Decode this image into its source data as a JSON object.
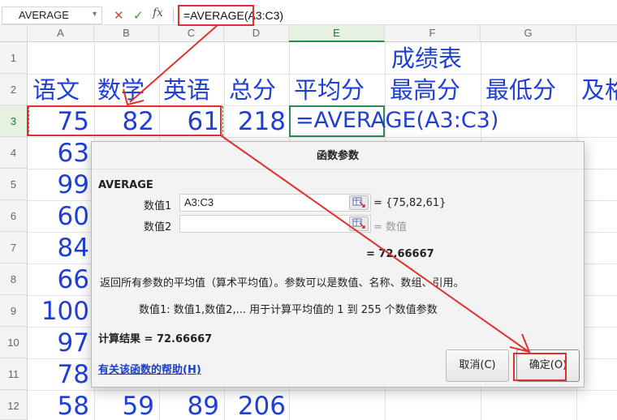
{
  "formula_bar": {
    "name_box": "AVERAGE",
    "cancel_symbol": "✕",
    "confirm_symbol": "✓",
    "fx_symbol": "fx",
    "formula": "=AVERAGE(A3:C3)"
  },
  "columns": [
    "A",
    "B",
    "C",
    "D",
    "E",
    "F",
    "G"
  ],
  "rows": [
    "1",
    "2",
    "3",
    "4",
    "5",
    "6",
    "7",
    "8",
    "9",
    "10",
    "11",
    "12"
  ],
  "sheet": {
    "title": "成绩表",
    "headers": [
      "语文",
      "数学",
      "英语",
      "总分",
      "平均分",
      "最高分",
      "最低分",
      "及格"
    ],
    "row3": {
      "a": "75",
      "b": "82",
      "c": "61",
      "d": "218",
      "e": "=AVERAGE(A3:C3)"
    },
    "col_a": [
      "63",
      "99",
      "60",
      "84",
      "66",
      "100",
      "97",
      "78",
      "58"
    ],
    "row12": {
      "b": "59",
      "c": "89",
      "d": "206"
    }
  },
  "dialog": {
    "title": "函数参数",
    "function_name": "AVERAGE",
    "arg1_label": "数值1",
    "arg1_value": "A3:C3",
    "arg1_result": "= {75,82,61}",
    "arg2_label": "数值2",
    "arg2_value": "",
    "arg2_result": "= 数值",
    "result_line": "= 72.66667",
    "description": "返回所有参数的平均值（算术平均值）。参数可以是数值、名称、数组、引用。",
    "param_description": "数值1:  数值1,数值2,... 用于计算平均值的 1 到 255 个数值参数",
    "calc_result": "计算结果 = 72.66667",
    "help_link": "有关该函数的帮助(H)",
    "cancel_button": "取消(C)",
    "ok_button": "确定(O)"
  },
  "colors": {
    "cell_text": "#1f3fd6",
    "annotation_red": "#e03030",
    "active_green": "#2e8b57",
    "link_blue": "#1a3ec8"
  }
}
